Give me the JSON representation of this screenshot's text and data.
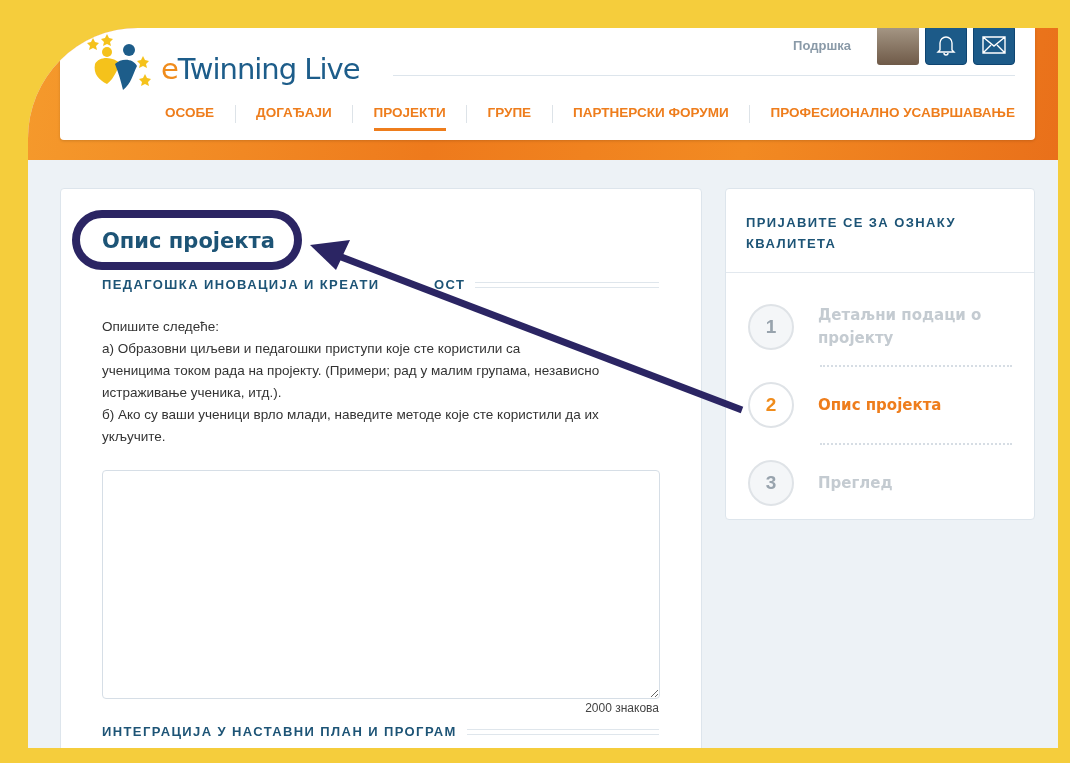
{
  "header": {
    "logo": "eTwinning Live",
    "support_link": "Подршка",
    "nav": [
      {
        "label": "ОСОБЕ",
        "selected": false
      },
      {
        "label": "ДОГАЂАЈИ",
        "selected": false
      },
      {
        "label": "ПРОЈЕКТИ",
        "selected": true
      },
      {
        "label": "ГРУПЕ",
        "selected": false
      },
      {
        "label": "ПАРТНЕРСКИ ФОРУМИ",
        "selected": false
      },
      {
        "label": "ПРОФЕСИОНАЛНО УСАВРШАВАЊЕ",
        "selected": false
      }
    ]
  },
  "main": {
    "title": "Опис пројекта",
    "sections": [
      {
        "heading": [
          "ПЕДАГОШКА ИНОВАЦИЈА И КРЕАТИ",
          "ОСТ"
        ],
        "instructions": [
          "Опишите следеће:",
          "а) Образовни циљеви и педагошки приступи које сте користили са",
          "ученицима током рада на пројекту. (Примери; рад у малим групама, независно",
          "истраживање ученика, итд.).",
          "б) Ако су ваши ученици врло млади, наведите методе које сте користили да их",
          "укључите."
        ],
        "char_limit": "2000 знакова"
      },
      {
        "heading": [
          "ИНТЕГРАЦИЈА У НАСТАВНИ ПЛАН И ПРОГРАМ"
        ]
      }
    ]
  },
  "sidebar": {
    "title": "ПРИЈАВИТЕ СЕ ЗА ОЗНАКУ КВАЛИТЕТА",
    "steps": [
      {
        "number": "1",
        "label": "Детаљни подаци о пројекту",
        "selected": false
      },
      {
        "number": "2",
        "label": "Опис пројекта",
        "selected": true
      },
      {
        "number": "3",
        "label": "Преглед",
        "selected": false
      }
    ]
  }
}
